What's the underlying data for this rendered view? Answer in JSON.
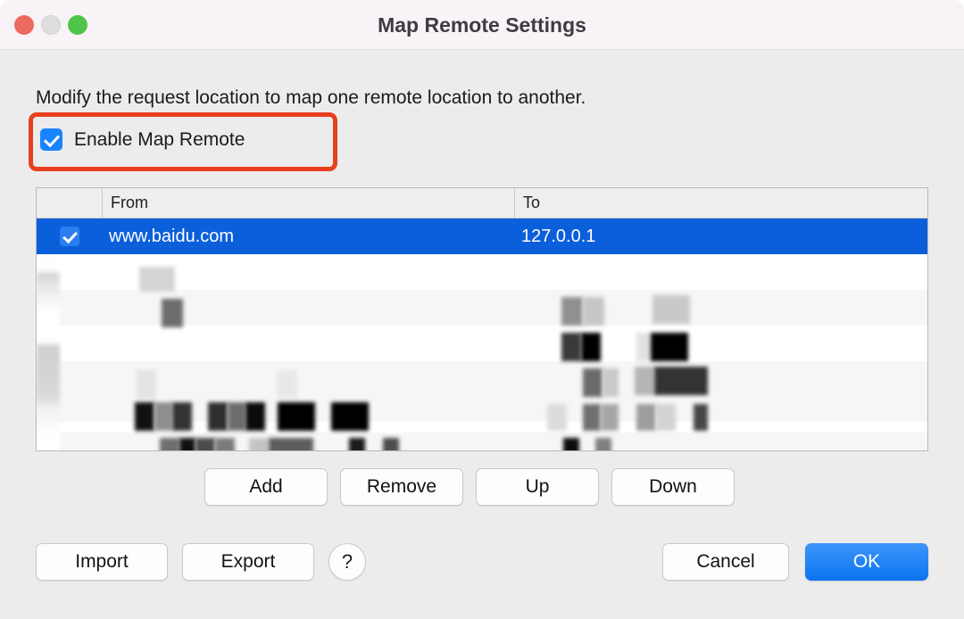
{
  "window": {
    "title": "Map Remote Settings",
    "traffic_lights": [
      "close-button",
      "minimize-button",
      "zoom-button"
    ]
  },
  "content": {
    "description": "Modify the request location to map one remote location to another.",
    "enable_checkbox": {
      "label": "Enable Map Remote",
      "checked": true
    },
    "annotation": {
      "shape": "rectangle",
      "color": "#e8401f",
      "target": "enable-map-remote-checkbox"
    }
  },
  "table": {
    "columns": [
      "From",
      "To"
    ],
    "rows": [
      {
        "checked": true,
        "from": "www.baidu.com",
        "to": "127.0.0.1",
        "selected": true
      }
    ],
    "redacted_rows_note": ""
  },
  "buttons": {
    "add": "Add",
    "remove": "Remove",
    "up": "Up",
    "down": "Down",
    "import": "Import",
    "export": "Export",
    "help": "?",
    "cancel": "Cancel",
    "ok": "OK"
  },
  "colors": {
    "accent": "#0b74f0",
    "selection": "#0b5fdb",
    "annotation": "#e8401f",
    "checkbox": "#1a84ff"
  }
}
